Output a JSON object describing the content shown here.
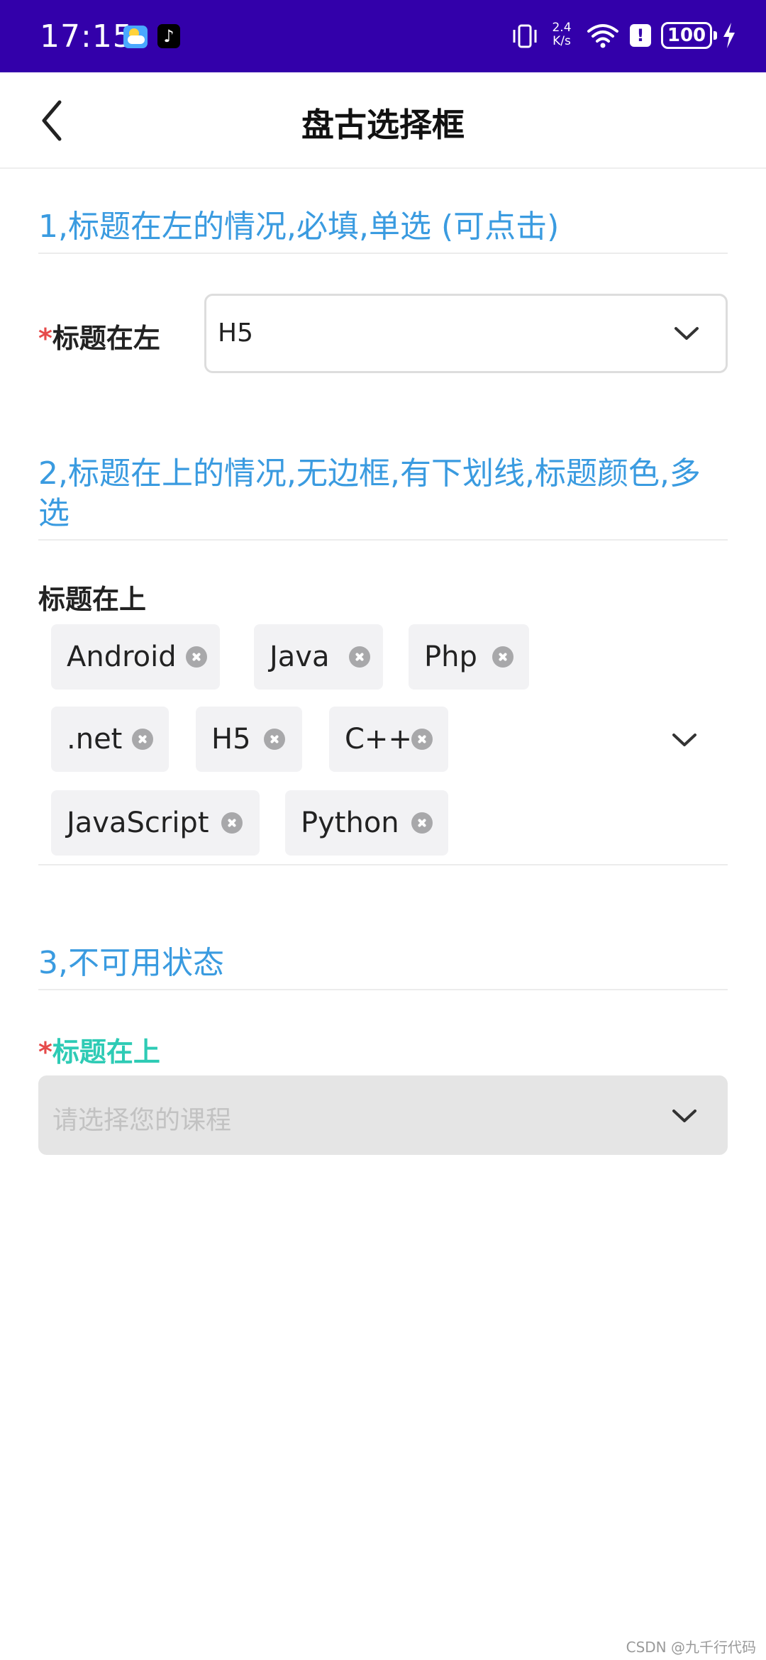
{
  "status_bar": {
    "time": "17:15",
    "net_speed_value": "2.4",
    "net_speed_unit": "K/s",
    "battery": "100",
    "icons": [
      "weather-icon",
      "tiktok-icon",
      "vibrate-icon",
      "wifi-icon",
      "alert-icon",
      "battery-icon",
      "charging-icon"
    ]
  },
  "nav": {
    "title": "盘古选择框",
    "back_icon": "chevron-left-icon"
  },
  "section1": {
    "title": "1,标题在左的情况,必填,单选 (可点击)",
    "required_mark": "*",
    "label": "标题在左",
    "value": "H5",
    "dropdown_icon": "chevron-down-icon"
  },
  "section2": {
    "title": "2,标题在上的情况,无边框,有下划线,标题颜色,多选",
    "label": "标题在上",
    "tags": [
      "Android",
      "Java",
      "Php",
      ".net",
      "H5",
      "C++",
      "JavaScript",
      "Python"
    ],
    "dropdown_icon": "chevron-down-icon"
  },
  "section3": {
    "title": "3,不可用状态",
    "required_mark": "*",
    "label": "标题在上",
    "label_color": "#2ecbb5",
    "placeholder": "请选择您的课程",
    "dropdown_icon": "chevron-down-icon"
  },
  "colors": {
    "status_bar": "#3300aa",
    "section_title": "#3a9be0",
    "required": "#e64b4b"
  },
  "watermark": "CSDN @九千行代码"
}
